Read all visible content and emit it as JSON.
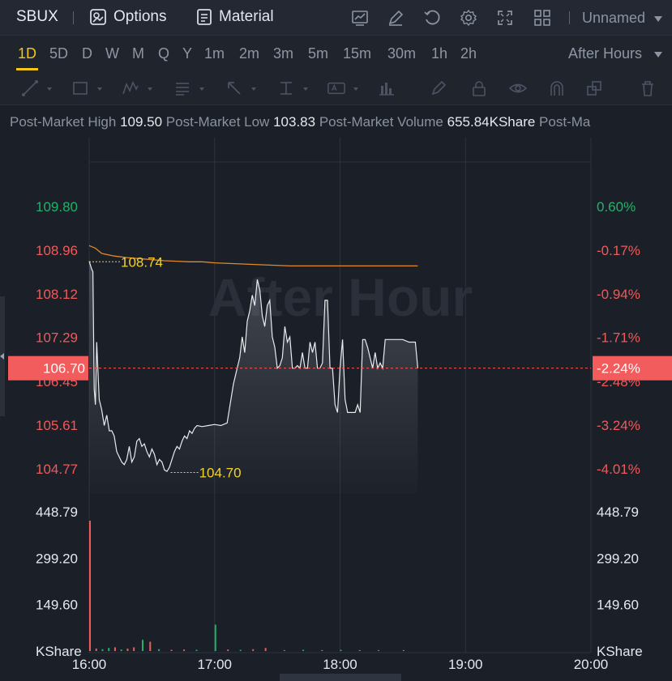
{
  "header": {
    "symbol": "SBUX",
    "options_label": "Options",
    "material_label": "Material",
    "layout_name": "Unnamed",
    "icons": [
      "chart-settings-icon",
      "edit-icon",
      "refresh-icon",
      "gear-icon",
      "fullscreen-icon",
      "grid-layout-icon"
    ]
  },
  "periods": {
    "items": [
      "1D",
      "5D",
      "D",
      "W",
      "M",
      "Q",
      "Y",
      "1m",
      "2m",
      "3m",
      "5m",
      "15m",
      "30m",
      "1h",
      "2h"
    ],
    "active": "1D",
    "session": "After Hours"
  },
  "stats": {
    "high_label": "Post-Market High",
    "high_value": "109.50",
    "low_label": "Post-Market Low",
    "low_value": "103.83",
    "volume_label": "Post-Market Volume",
    "volume_value": "655.84KShare",
    "more_label": "Post-Ma"
  },
  "chart_data": {
    "type": "line",
    "watermark": "After Hour",
    "x_ticks": [
      "16:00",
      "17:00",
      "18:00",
      "19:00",
      "20:00"
    ],
    "x_range_hours": [
      16,
      20
    ],
    "price_axis": {
      "ticks": [
        "109.80",
        "108.96",
        "108.12",
        "107.29",
        "106.45",
        "105.61",
        "104.77"
      ],
      "ylim": [
        104.77,
        109.8
      ]
    },
    "percent_axis": {
      "ticks": [
        "0.60%",
        "-0.17%",
        "-0.94%",
        "-1.71%",
        "-2.48%",
        "-3.24%",
        "-4.01%"
      ]
    },
    "current_price": "106.70",
    "current_change": "-2.24%",
    "high_marker": {
      "value": "108.74",
      "time": 16.0
    },
    "low_marker": {
      "value": "104.70",
      "time": 16.65
    },
    "price_series": [
      [
        16.0,
        108.75
      ],
      [
        16.02,
        108.6
      ],
      [
        16.03,
        108.55
      ],
      [
        16.04,
        106.3
      ],
      [
        16.05,
        106.0
      ],
      [
        16.06,
        107.2
      ],
      [
        16.08,
        106.1
      ],
      [
        16.1,
        105.9
      ],
      [
        16.12,
        105.6
      ],
      [
        16.14,
        105.8
      ],
      [
        16.16,
        105.5
      ],
      [
        16.18,
        105.5
      ],
      [
        16.2,
        105.4
      ],
      [
        16.22,
        105.1
      ],
      [
        16.24,
        105.0
      ],
      [
        16.26,
        104.9
      ],
      [
        16.28,
        104.85
      ],
      [
        16.3,
        104.95
      ],
      [
        16.32,
        105.2
      ],
      [
        16.34,
        104.9
      ],
      [
        16.36,
        105.0
      ],
      [
        16.38,
        105.3
      ],
      [
        16.4,
        105.35
      ],
      [
        16.42,
        105.2
      ],
      [
        16.44,
        105.25
      ],
      [
        16.46,
        105.1
      ],
      [
        16.48,
        105.0
      ],
      [
        16.5,
        105.15
      ],
      [
        16.52,
        105.05
      ],
      [
        16.54,
        104.85
      ],
      [
        16.56,
        104.95
      ],
      [
        16.58,
        104.9
      ],
      [
        16.6,
        104.75
      ],
      [
        16.62,
        104.72
      ],
      [
        16.64,
        104.8
      ],
      [
        16.66,
        104.95
      ],
      [
        16.68,
        105.1
      ],
      [
        16.7,
        105.2
      ],
      [
        16.72,
        105.15
      ],
      [
        16.74,
        105.3
      ],
      [
        16.76,
        105.4
      ],
      [
        16.78,
        105.35
      ],
      [
        16.8,
        105.5
      ],
      [
        16.82,
        105.45
      ],
      [
        16.84,
        105.55
      ],
      [
        16.86,
        105.6
      ],
      [
        16.9,
        105.58
      ],
      [
        16.95,
        105.6
      ],
      [
        17.0,
        105.62
      ],
      [
        17.05,
        105.6
      ],
      [
        17.1,
        105.65
      ],
      [
        17.15,
        106.4
      ],
      [
        17.2,
        106.9
      ],
      [
        17.22,
        107.3
      ],
      [
        17.24,
        107.0
      ],
      [
        17.26,
        107.6
      ],
      [
        17.28,
        107.8
      ],
      [
        17.3,
        108.1
      ],
      [
        17.32,
        107.9
      ],
      [
        17.34,
        108.4
      ],
      [
        17.36,
        108.2
      ],
      [
        17.38,
        107.7
      ],
      [
        17.4,
        107.5
      ],
      [
        17.42,
        107.9
      ],
      [
        17.44,
        108.0
      ],
      [
        17.46,
        107.3
      ],
      [
        17.48,
        107.1
      ],
      [
        17.5,
        106.7
      ],
      [
        17.52,
        106.75
      ],
      [
        17.54,
        106.9
      ],
      [
        17.56,
        107.5
      ],
      [
        17.58,
        107.2
      ],
      [
        17.6,
        107.3
      ],
      [
        17.62,
        106.7
      ],
      [
        17.64,
        106.7
      ],
      [
        17.66,
        106.75
      ],
      [
        17.68,
        106.7
      ],
      [
        17.7,
        107.0
      ],
      [
        17.72,
        106.7
      ],
      [
        17.74,
        106.7
      ],
      [
        17.76,
        107.2
      ],
      [
        17.78,
        107.0
      ],
      [
        17.8,
        107.2
      ],
      [
        17.82,
        106.7
      ],
      [
        17.84,
        106.7
      ],
      [
        17.86,
        106.8
      ],
      [
        17.88,
        108.0
      ],
      [
        17.9,
        108.0
      ],
      [
        17.92,
        106.7
      ],
      [
        17.94,
        106.7
      ],
      [
        17.96,
        106.0
      ],
      [
        17.98,
        105.85
      ],
      [
        18.0,
        106.7
      ],
      [
        18.02,
        107.25
      ],
      [
        18.04,
        106.1
      ],
      [
        18.06,
        105.85
      ],
      [
        18.08,
        105.85
      ],
      [
        18.1,
        105.85
      ],
      [
        18.12,
        105.85
      ],
      [
        18.14,
        106.0
      ],
      [
        18.16,
        105.85
      ],
      [
        18.18,
        107.25
      ],
      [
        18.2,
        107.25
      ],
      [
        18.22,
        107.1
      ],
      [
        18.24,
        106.9
      ],
      [
        18.26,
        106.7
      ],
      [
        18.28,
        107.0
      ],
      [
        18.3,
        106.7
      ],
      [
        18.32,
        106.8
      ],
      [
        18.34,
        106.7
      ],
      [
        18.36,
        107.25
      ],
      [
        18.4,
        107.25
      ],
      [
        18.45,
        107.25
      ],
      [
        18.5,
        107.25
      ],
      [
        18.55,
        107.2
      ],
      [
        18.6,
        107.2
      ],
      [
        18.62,
        106.7
      ]
    ],
    "avg_series": [
      [
        16.0,
        109.05
      ],
      [
        16.05,
        109.0
      ],
      [
        16.1,
        108.9
      ],
      [
        16.2,
        108.85
      ],
      [
        16.3,
        108.82
      ],
      [
        16.4,
        108.8
      ],
      [
        16.5,
        108.78
      ],
      [
        16.6,
        108.76
      ],
      [
        16.7,
        108.75
      ],
      [
        16.8,
        108.74
      ],
      [
        16.9,
        108.74
      ],
      [
        17.0,
        108.72
      ],
      [
        17.2,
        108.7
      ],
      [
        17.4,
        108.68
      ],
      [
        17.6,
        108.66
      ],
      [
        17.8,
        108.66
      ],
      [
        18.0,
        108.66
      ],
      [
        18.2,
        108.66
      ],
      [
        18.4,
        108.66
      ],
      [
        18.62,
        108.66
      ]
    ],
    "volume_axis": {
      "ticks": [
        "448.79",
        "299.20",
        "149.60",
        "KShare"
      ],
      "ylim": [
        0,
        448.79
      ]
    },
    "volume_series": [
      {
        "t": 16.0,
        "v": 420,
        "dir": "down"
      },
      {
        "t": 16.05,
        "v": 8,
        "dir": "down"
      },
      {
        "t": 16.1,
        "v": 6,
        "dir": "up"
      },
      {
        "t": 16.15,
        "v": 10,
        "dir": "up"
      },
      {
        "t": 16.2,
        "v": 12,
        "dir": "down"
      },
      {
        "t": 16.25,
        "v": 5,
        "dir": "up"
      },
      {
        "t": 16.3,
        "v": 8,
        "dir": "down"
      },
      {
        "t": 16.35,
        "v": 12,
        "dir": "down"
      },
      {
        "t": 16.42,
        "v": 36,
        "dir": "up"
      },
      {
        "t": 16.48,
        "v": 30,
        "dir": "down"
      },
      {
        "t": 16.55,
        "v": 6,
        "dir": "up"
      },
      {
        "t": 16.65,
        "v": 4,
        "dir": "down"
      },
      {
        "t": 16.75,
        "v": 5,
        "dir": "down"
      },
      {
        "t": 16.85,
        "v": 4,
        "dir": "up"
      },
      {
        "t": 17.0,
        "v": 85,
        "dir": "up"
      },
      {
        "t": 17.1,
        "v": 5,
        "dir": "down"
      },
      {
        "t": 17.2,
        "v": 4,
        "dir": "up"
      },
      {
        "t": 17.3,
        "v": 6,
        "dir": "down"
      },
      {
        "t": 17.4,
        "v": 10,
        "dir": "down"
      },
      {
        "t": 17.55,
        "v": 3,
        "dir": "up"
      },
      {
        "t": 17.7,
        "v": 4,
        "dir": "up"
      },
      {
        "t": 17.85,
        "v": 3,
        "dir": "down"
      },
      {
        "t": 18.0,
        "v": 4,
        "dir": "up"
      },
      {
        "t": 18.15,
        "v": 3,
        "dir": "down"
      },
      {
        "t": 18.3,
        "v": 3,
        "dir": "up"
      },
      {
        "t": 18.5,
        "v": 3,
        "dir": "down"
      }
    ],
    "colors": {
      "up": "#21b26a",
      "down": "#f05a5a",
      "line": "#e8eaee",
      "avg": "#e28a2a",
      "marker": "#f2d22c",
      "badge": "#f25c5c",
      "grid": "#2c323d"
    }
  }
}
